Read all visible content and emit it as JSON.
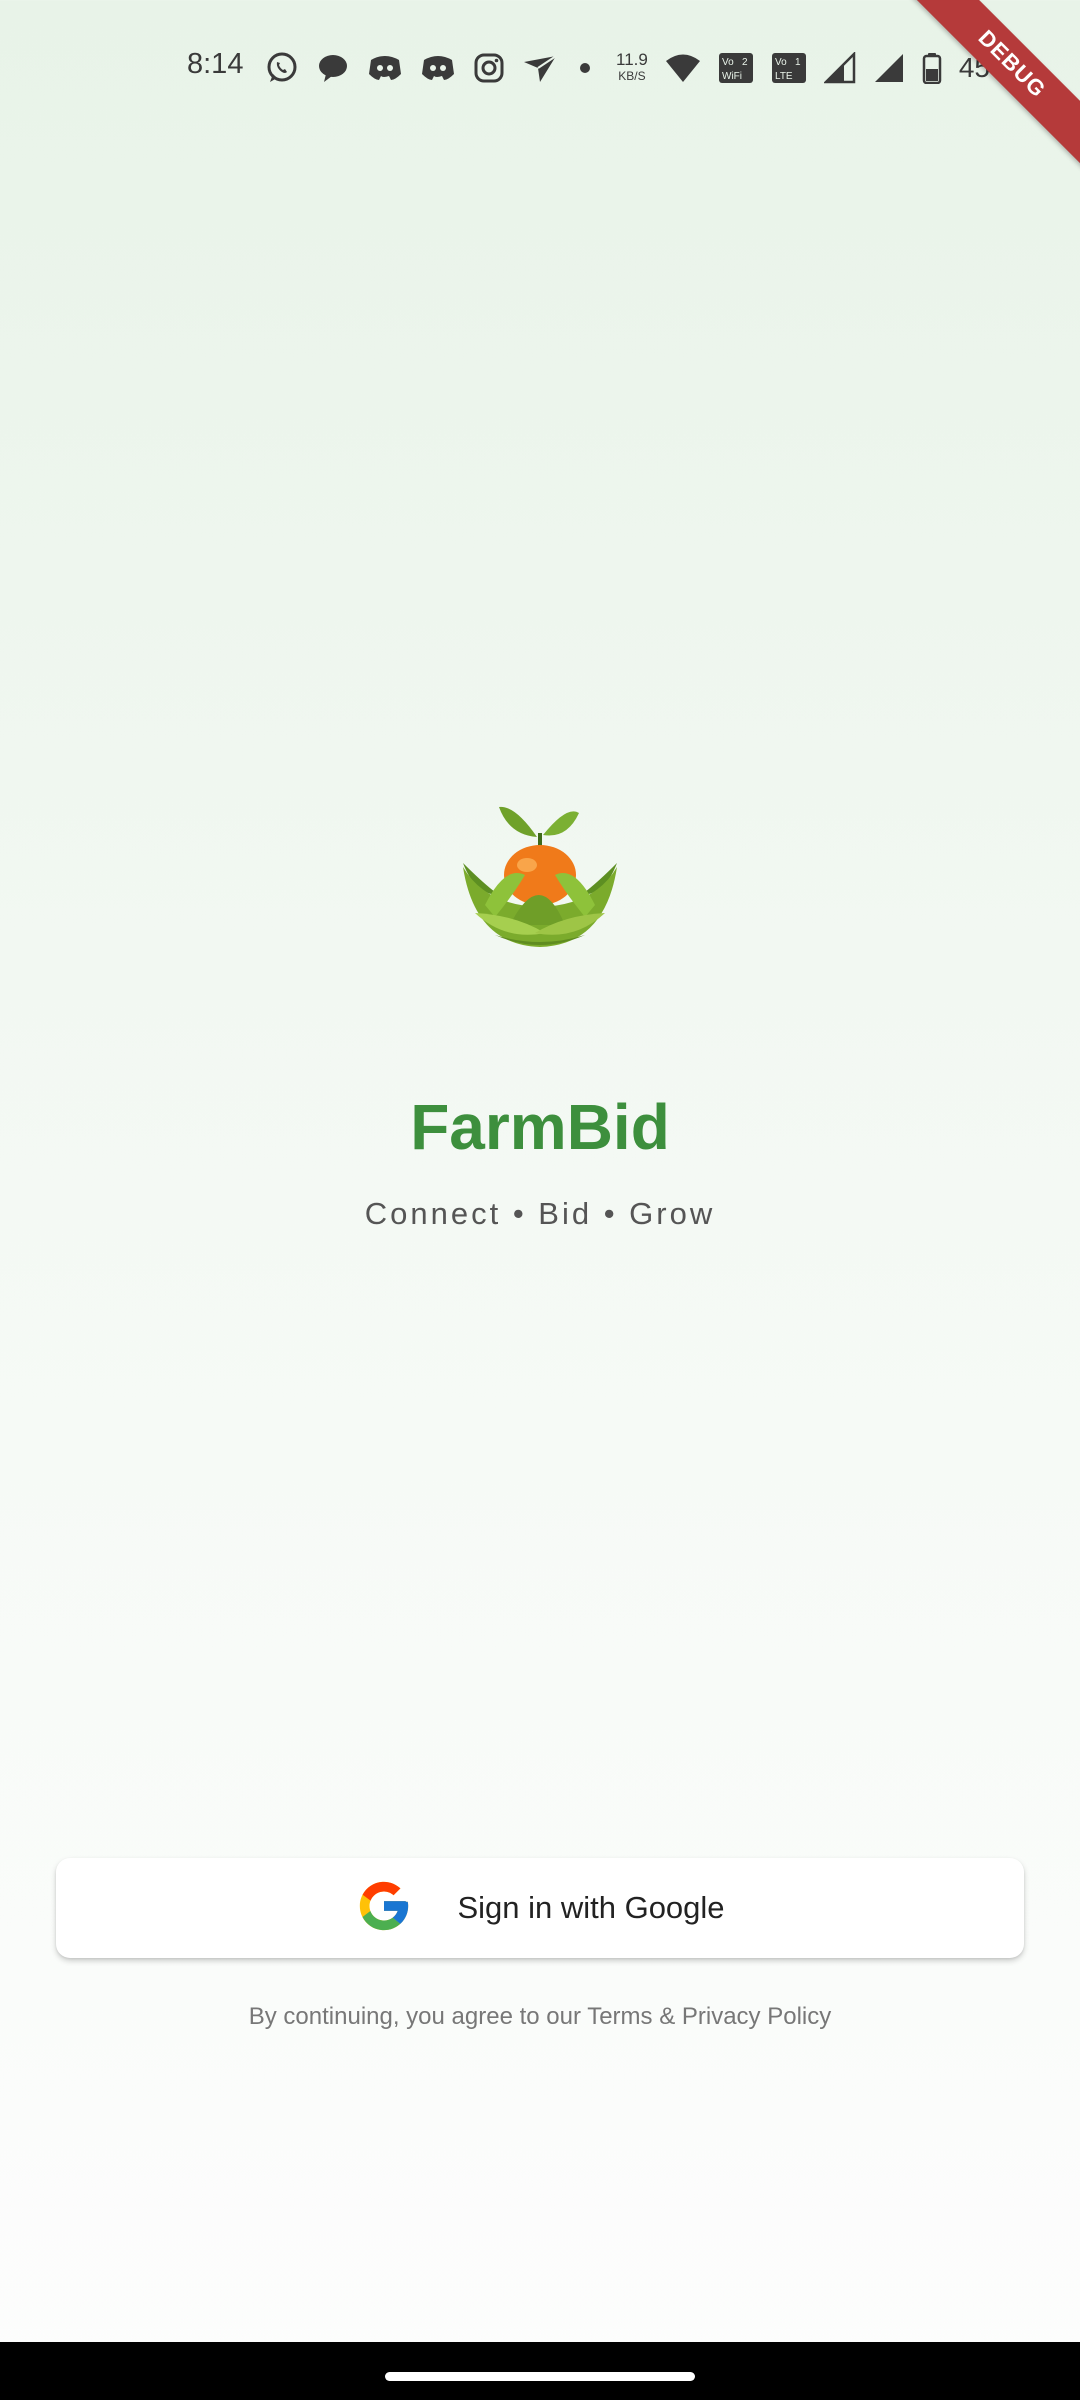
{
  "status_bar": {
    "time": "8:14",
    "net_speed_value": "11.9",
    "net_speed_unit": "KB/S",
    "sim1_label_top": "Vo",
    "sim1_label_bottom": "WiFi",
    "sim1_number": "2",
    "sim2_label_top": "Vo",
    "sim2_label_bottom": "LTE",
    "sim2_number": "1",
    "battery_percent": "45%",
    "icons": [
      "whatsapp-icon",
      "chat-bubble-icon",
      "discord-icon",
      "discord-icon",
      "instagram-icon",
      "send-icon",
      "dot-icon",
      "wifi-icon",
      "signal-icon",
      "signal-icon",
      "battery-icon"
    ]
  },
  "debug_banner": "DEBUG",
  "app": {
    "name": "FarmBid",
    "tagline": "Connect • Bid • Grow"
  },
  "auth": {
    "google_button_label": "Sign in with Google",
    "terms_text": "By continuing, you agree to our Terms & Privacy Policy"
  },
  "colors": {
    "brand_green": "#3d8f3d",
    "debug_red": "#b53a3a",
    "background_top": "#e8f3e8"
  }
}
